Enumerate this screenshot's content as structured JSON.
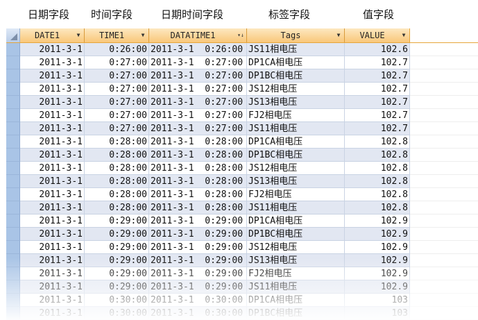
{
  "annotations": {
    "date_field": "日期字段",
    "time_field": "时间字段",
    "datetime_field": "日期时间字段",
    "tag_field": "标签字段",
    "value_field": "值字段"
  },
  "columns": [
    "DATE1",
    "TIME1",
    "DATATIME1",
    "Tags",
    "VALUE"
  ],
  "rows": [
    [
      "2011-3-1",
      "0:26:00",
      "2011-3-1  0:26:00",
      "JS11相电压",
      "102.6"
    ],
    [
      "2011-3-1",
      "0:27:00",
      "2011-3-1  0:27:00",
      "DP1CA相电压",
      "102.7"
    ],
    [
      "2011-3-1",
      "0:27:00",
      "2011-3-1  0:27:00",
      "DP1BC相电压",
      "102.7"
    ],
    [
      "2011-3-1",
      "0:27:00",
      "2011-3-1  0:27:00",
      "JS12相电压",
      "102.7"
    ],
    [
      "2011-3-1",
      "0:27:00",
      "2011-3-1  0:27:00",
      "JS13相电压",
      "102.7"
    ],
    [
      "2011-3-1",
      "0:27:00",
      "2011-3-1  0:27:00",
      "FJ2相电压",
      "102.7"
    ],
    [
      "2011-3-1",
      "0:27:00",
      "2011-3-1  0:27:00",
      "JS11相电压",
      "102.7"
    ],
    [
      "2011-3-1",
      "0:28:00",
      "2011-3-1  0:28:00",
      "DP1CA相电压",
      "102.8"
    ],
    [
      "2011-3-1",
      "0:28:00",
      "2011-3-1  0:28:00",
      "DP1BC相电压",
      "102.8"
    ],
    [
      "2011-3-1",
      "0:28:00",
      "2011-3-1  0:28:00",
      "JS12相电压",
      "102.8"
    ],
    [
      "2011-3-1",
      "0:28:00",
      "2011-3-1  0:28:00",
      "JS13相电压",
      "102.8"
    ],
    [
      "2011-3-1",
      "0:28:00",
      "2011-3-1  0:28:00",
      "FJ2相电压",
      "102.8"
    ],
    [
      "2011-3-1",
      "0:28:00",
      "2011-3-1  0:28:00",
      "JS11相电压",
      "102.8"
    ],
    [
      "2011-3-1",
      "0:29:00",
      "2011-3-1  0:29:00",
      "DP1CA相电压",
      "102.9"
    ],
    [
      "2011-3-1",
      "0:29:00",
      "2011-3-1  0:29:00",
      "DP1BC相电压",
      "102.9"
    ],
    [
      "2011-3-1",
      "0:29:00",
      "2011-3-1  0:29:00",
      "JS12相电压",
      "102.9"
    ],
    [
      "2011-3-1",
      "0:29:00",
      "2011-3-1  0:29:00",
      "JS13相电压",
      "102.9"
    ],
    [
      "2011-3-1",
      "0:29:00",
      "2011-3-1  0:29:00",
      "FJ2相电压",
      "102.9"
    ],
    [
      "2011-3-1",
      "0:29:00",
      "2011-3-1  0:29:00",
      "JS11相电压",
      "102.9"
    ],
    [
      "2011-3-1",
      "0:30:00",
      "2011-3-1  0:30:00",
      "DP1CA相电压",
      "103"
    ],
    [
      "2011-3-1",
      "0:30:00",
      "2011-3-1  0:30:00",
      "DP1BC相电压",
      "103"
    ]
  ],
  "colors": {
    "header_bg": "#f9c77a",
    "header_border": "#e6a63b",
    "row_alt_bg": "#e2e7f2",
    "selector_bg": "#a9c4e6"
  },
  "icons": {
    "dropdown": "dropdown-arrow-icon",
    "sort_filter": "sort-filter-icon"
  }
}
